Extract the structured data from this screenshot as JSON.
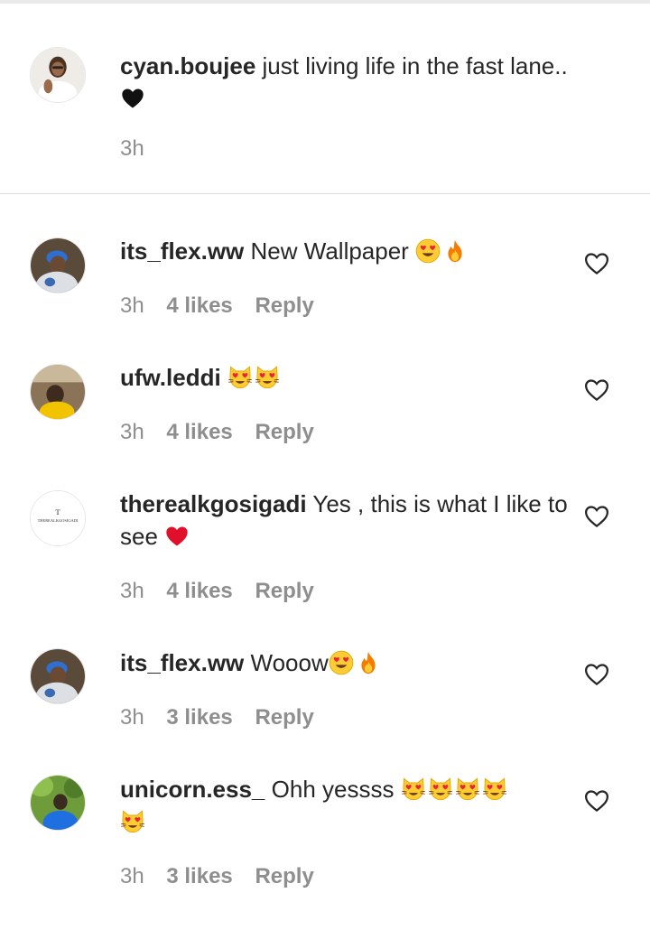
{
  "caption": {
    "username": "cyan.boujee",
    "text": "just living life in the fast lane..",
    "time": "3h"
  },
  "comments": [
    {
      "username": "its_flex.ww",
      "text": "New Wallpaper",
      "time": "3h",
      "likes": "4 likes",
      "reply": "Reply"
    },
    {
      "username": "ufw.leddi",
      "text": "",
      "time": "3h",
      "likes": "4 likes",
      "reply": "Reply"
    },
    {
      "username": "therealkgosigadi",
      "text": "Yes , this is what I like to see",
      "avatar_text": "THEREALKGOSIGADI",
      "avatar_letter": "T",
      "time": "3h",
      "likes": "4 likes",
      "reply": "Reply"
    },
    {
      "username": "its_flex.ww",
      "text": "Wooow",
      "time": "3h",
      "likes": "3 likes",
      "reply": "Reply"
    },
    {
      "username": "unicorn.ess_",
      "text": "Ohh yessss",
      "time": "3h",
      "likes": "3 likes",
      "reply": "Reply"
    }
  ],
  "icons": {
    "like": "heart-outline-icon",
    "black_heart": "black-heart-emoji",
    "red_heart": "red-heart-emoji",
    "heart_eyes": "heart-eyes-emoji",
    "fire": "fire-emoji",
    "heart_eyes_cat": "heart-eyes-cat-emoji"
  },
  "colors": {
    "text": "#262626",
    "muted": "#8e8e8e",
    "divider": "#dbdbdb",
    "red_heart": "#e0102a"
  }
}
